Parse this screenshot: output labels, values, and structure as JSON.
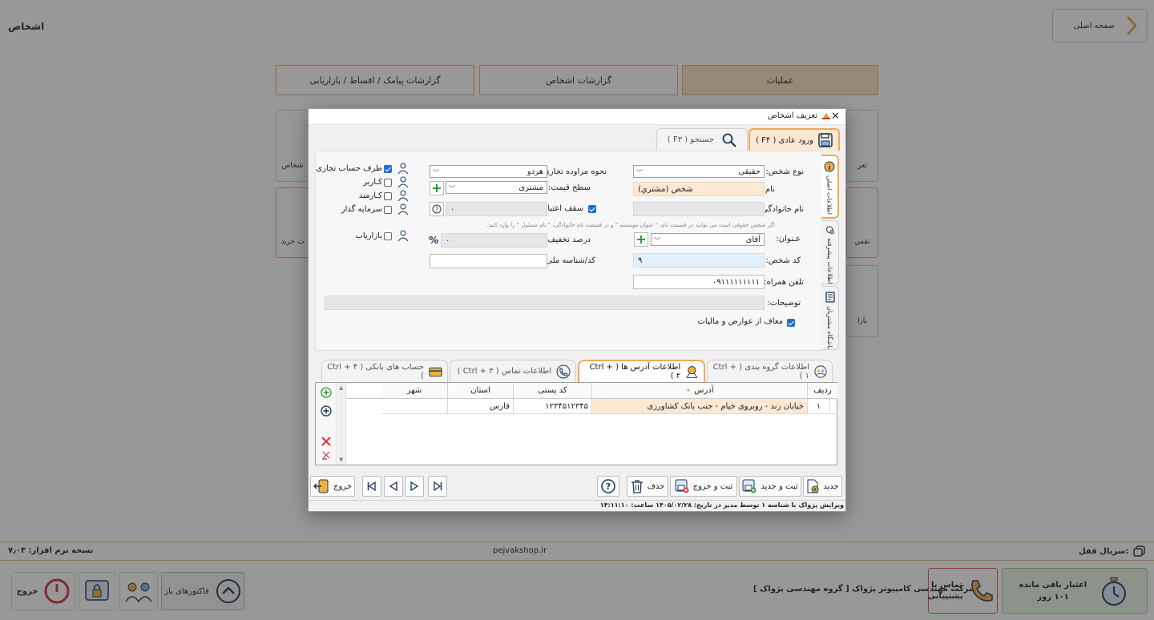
{
  "app": {
    "title": "اشخاص",
    "home_button": "صفحه اصلی",
    "tabs": [
      {
        "label": "گزارشات پیامک / اقساط / بازاریابی"
      },
      {
        "label": "گزارشات اشخاص"
      },
      {
        "label": "عملیات"
      }
    ],
    "tiles": [
      {
        "label": "تعر"
      },
      {
        "label": "شخاص"
      },
      {
        "label": "تقس"
      },
      {
        "label": "ت خرید"
      },
      {
        "label": "بازا"
      }
    ],
    "status": {
      "version": "نسخه نرم افزار: ۷٫۰۳",
      "site": "pejvakshop.ir",
      "serial": "سریال قفل:"
    },
    "footer": {
      "exit": "خروج",
      "open_invoices": "فاکتورهای باز",
      "company": "شرکت مهندسی کامپیوتر پژواک [ گروه مهندسی پژواک ]",
      "support": "تماس با پشتیبانی",
      "remaining_title": "اعتبار باقی مانده",
      "remaining_days": "۱۰۱ روز"
    }
  },
  "dialog": {
    "title": "تعریف اشخاص",
    "tabs": {
      "normal": "ورود عادی ( F۴ )",
      "search": "جستجو ( F۳ )"
    },
    "side_tabs": [
      "اطلاعات اصلی",
      "اطلاعات پیشرفته",
      "باشگاه مشتریان"
    ],
    "form": {
      "person_type_label": "نوع شخص:",
      "person_type_value": "حقیقی",
      "name_label": "نام:",
      "name_value": "شخص (مشتري)",
      "family_label": "نام خانوادگی:",
      "family_value": "",
      "hint": "اگر شخص حقوقی است می توانید در قسمت نام، \" عنوان موسسه \" و در قسمت نام خانوادگی، \" نام مسئول \" را وارد کنید.",
      "honorific_label": "عـنوان:",
      "honorific_value": "آقای",
      "code_label": "کد شخص:",
      "code_value": "۹",
      "mobile_label": "تلفن همراه:",
      "mobile_value": "۰۹۱۱۱۱۱۱۱۱۱",
      "desc_label": "توضیحات:",
      "desc_value": "",
      "tax_exempt": "معاف از عوارض و مالیات",
      "trade_label": "نحوه مراوده تجاری:",
      "trade_value": "هردو",
      "price_level_label": "سطح قیمت:",
      "price_level_value": "مشتری",
      "credit_label": "سقف اعتبار:",
      "credit_value": "۰",
      "discount_label": "درصد تخفیف:",
      "discount_value": "۰",
      "national_label": "کد/شناسه ملی:",
      "national_value": "",
      "roles": [
        {
          "label": "طرف حساب تجاری",
          "checked": true
        },
        {
          "label": "کـاربر",
          "checked": false
        },
        {
          "label": "کـارمند",
          "checked": false
        },
        {
          "label": "سرمایه گذار",
          "checked": false
        }
      ],
      "marketer": "بازاریاب"
    },
    "grid_tabs": [
      "اطلاعات گروه بندی ( Ctrl + ۱ )",
      "اطلاعات آدرس ها ( Ctrl + ۲ )",
      "اطلاعات تماس ( Ctrl + ۳ )",
      "حساب های بانکی ( Ctrl + ۴ )"
    ],
    "table": {
      "headers": [
        "ردیف",
        "آدرس",
        "کد پستی",
        "استان",
        "شهر"
      ],
      "rows": [
        [
          "۱",
          "خیابان زند - روبروی خیام - جنب بانک کشاورزی",
          "۱۲۳۴۵۱۲۳۴۵",
          "فارس",
          ""
        ]
      ]
    },
    "buttons": {
      "new": "جدید",
      "save_new": "ثبت و جدید",
      "save_exit": "ثبت و خروج",
      "delete": "حذف",
      "exit": "خروج"
    },
    "status_bar": "ویرایش  پژواک  با شناسه ۱ توسط مدیر در تاریخ: ۱۴۰۵/۰۲/۲۸ ساعت: ۱۴:۱۱:۱۰"
  },
  "colors": {
    "accent": "#f0a95a",
    "blue": "#1f6fd0",
    "overlay": "#555555"
  }
}
